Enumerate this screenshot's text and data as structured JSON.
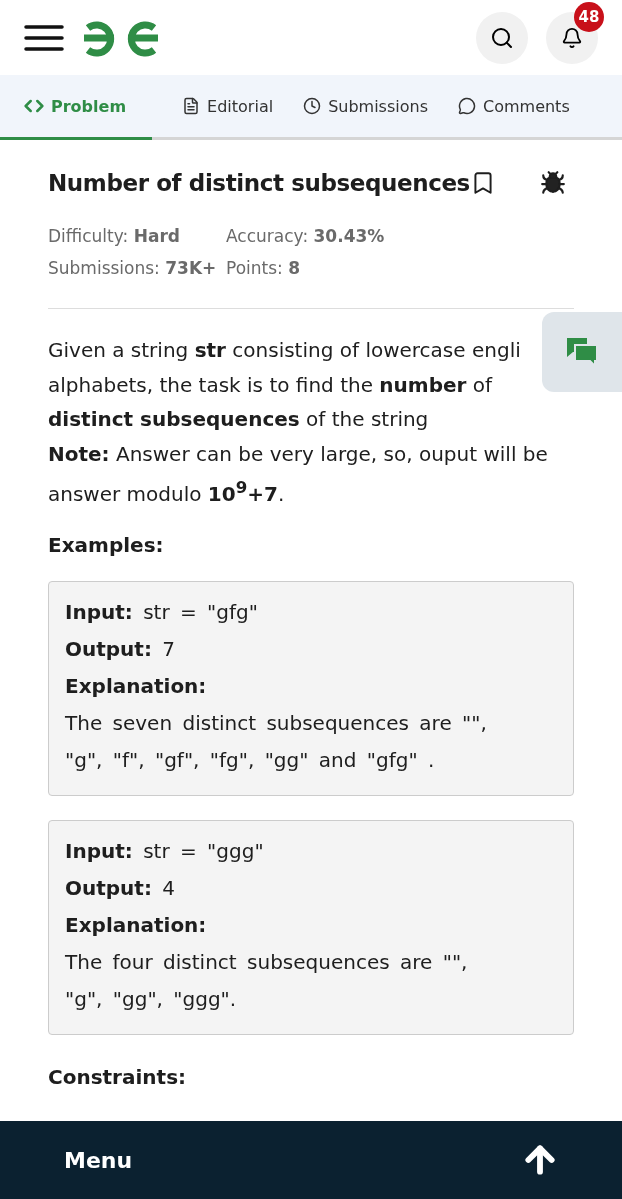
{
  "header": {
    "notification_count": "48"
  },
  "tabs": [
    {
      "label": "Problem",
      "selected": true
    },
    {
      "label": "Editorial",
      "selected": false
    },
    {
      "label": "Submissions",
      "selected": false
    },
    {
      "label": "Comments",
      "selected": false
    }
  ],
  "problem": {
    "title": "Number of distinct subsequences",
    "stats": [
      [
        {
          "label": "Difficulty:",
          "value": "Hard"
        },
        {
          "label": "Accuracy:",
          "value": "30.43%"
        }
      ],
      [
        {
          "label": "Submissions:",
          "value": "73K+"
        },
        {
          "label": "Points:",
          "value": "8"
        }
      ]
    ],
    "description_lines": [
      "Given a string **str** consisting of lowercase engli",
      "alphabets, the task is to find the **number** of",
      "**distinct subsequences** of the string"
    ],
    "note_lines": [
      "**Note:** Answer can be very large, so, ouput will be",
      "answer modulo **10$^{9}$+7**."
    ],
    "examples_heading": "Examples:",
    "examples": [
      {
        "input": "str = \"gfg\"",
        "output": "7",
        "explanation_label": "Explanation:",
        "explanation_lines": [
          "The seven distinct subsequences are \"\",",
          "\"g\", \"f\", \"gf\", \"fg\", \"gg\" and \"gfg\" ."
        ],
        "input_label": "Input:",
        "output_label": "Output:"
      },
      {
        "input": "str = \"ggg\"",
        "output": "4",
        "explanation_label": "Explanation:",
        "explanation_lines": [
          "The four distinct subsequences are \"\",",
          "\"g\", \"gg\", \"ggg\"."
        ],
        "input_label": "Input:",
        "output_label": "Output:"
      }
    ],
    "constraints_heading": "Constraints:"
  },
  "bottom_bar": {
    "menu_label": "Menu"
  }
}
